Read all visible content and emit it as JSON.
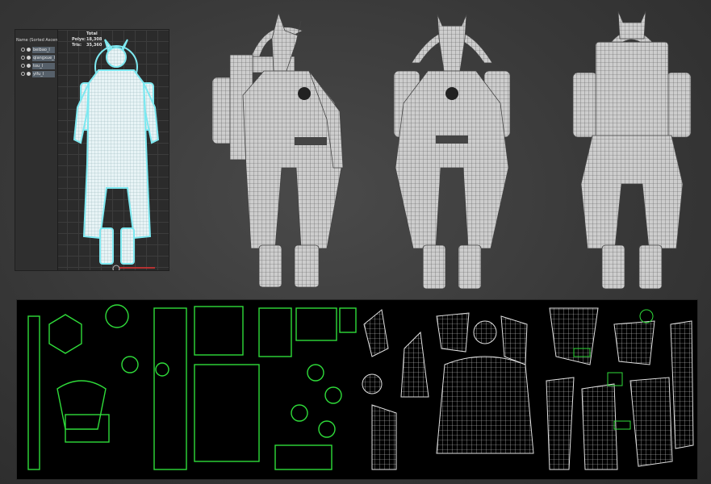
{
  "scene_explorer": {
    "header": "Name (Sorted Ascen",
    "layers": [
      "beibao_l",
      "qiangxue_l",
      "tou_l",
      "yifu_l"
    ]
  },
  "stats": {
    "total_label": "Total",
    "polys_label": "Polys:",
    "polys_value": "18,308",
    "tris_label": "Tris:",
    "tris_value": "35,360"
  },
  "colors": {
    "background": "#3a3a3a",
    "wire_selected": "#7de8f0",
    "uv_green": "#2fdc3a",
    "uv_background": "#000000",
    "model_shade": "#cfcfcf"
  },
  "views": [
    "viewport-selected-model",
    "model-view-side",
    "model-view-front",
    "model-view-back",
    "uv-layout"
  ]
}
